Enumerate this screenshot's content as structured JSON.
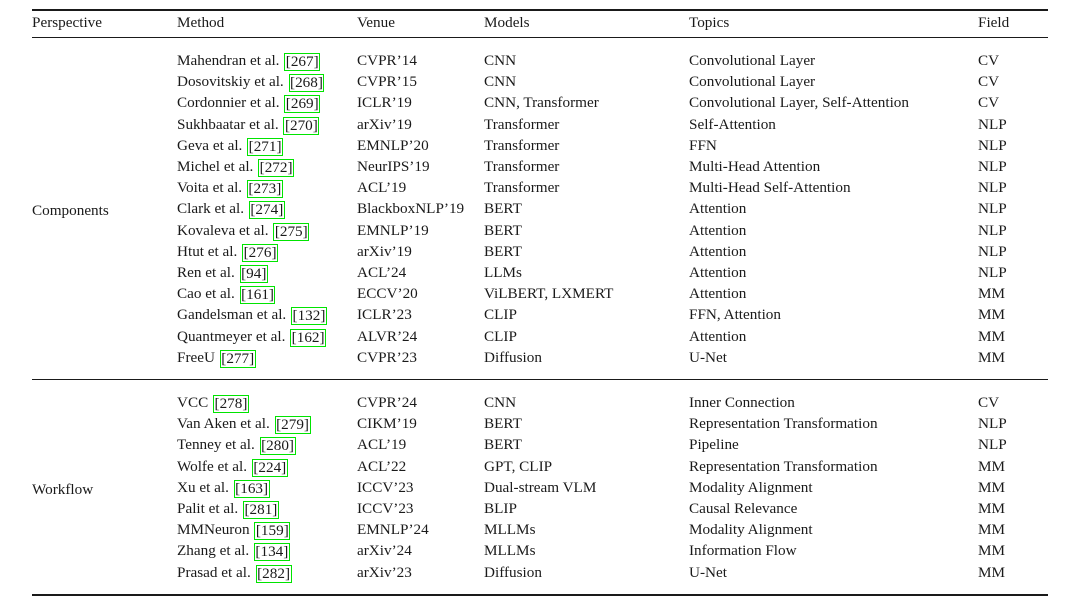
{
  "table": {
    "columns": [
      {
        "key": "perspective",
        "label": "Perspective"
      },
      {
        "key": "method",
        "label": "Method"
      },
      {
        "key": "venue",
        "label": "Venue"
      },
      {
        "key": "models",
        "label": "Models"
      },
      {
        "key": "topics",
        "label": "Topics"
      },
      {
        "key": "field",
        "label": "Field"
      }
    ],
    "citation_box_color": "#00e400",
    "rule_color": "#1a1a1a",
    "groups": [
      {
        "perspective": "Components",
        "rows": [
          {
            "method": "Mahendran et al.",
            "cite": "267",
            "venue": "CVPR’14",
            "models": "CNN",
            "topics": "Convolutional Layer",
            "field": "CV"
          },
          {
            "method": "Dosovitskiy et al.",
            "cite": "268",
            "venue": "CVPR’15",
            "models": "CNN",
            "topics": "Convolutional Layer",
            "field": "CV"
          },
          {
            "method": "Cordonnier et al.",
            "cite": "269",
            "venue": "ICLR’19",
            "models": "CNN, Transformer",
            "topics": "Convolutional Layer, Self-Attention",
            "field": "CV"
          },
          {
            "method": "Sukhbaatar et al.",
            "cite": "270",
            "venue": "arXiv’19",
            "models": "Transformer",
            "topics": "Self-Attention",
            "field": "NLP"
          },
          {
            "method": "Geva et al.",
            "cite": "271",
            "venue": "EMNLP’20",
            "models": "Transformer",
            "topics": "FFN",
            "field": "NLP"
          },
          {
            "method": "Michel et al.",
            "cite": "272",
            "venue": "NeurIPS’19",
            "models": "Transformer",
            "topics": "Multi-Head Attention",
            "field": "NLP"
          },
          {
            "method": "Voita et al.",
            "cite": "273",
            "venue": "ACL’19",
            "models": "Transformer",
            "topics": "Multi-Head Self-Attention",
            "field": "NLP"
          },
          {
            "method": "Clark et al.",
            "cite": "274",
            "venue": "BlackboxNLP’19",
            "models": "BERT",
            "topics": "Attention",
            "field": "NLP"
          },
          {
            "method": "Kovaleva et al.",
            "cite": "275",
            "venue": "EMNLP’19",
            "models": "BERT",
            "topics": "Attention",
            "field": "NLP"
          },
          {
            "method": "Htut et al.",
            "cite": "276",
            "venue": "arXiv’19",
            "models": "BERT",
            "topics": "Attention",
            "field": "NLP"
          },
          {
            "method": "Ren et al.",
            "cite": "94",
            "venue": "ACL’24",
            "models": "LLMs",
            "topics": "Attention",
            "field": "NLP"
          },
          {
            "method": "Cao et al.",
            "cite": "161",
            "venue": "ECCV’20",
            "models": "ViLBERT, LXMERT",
            "topics": "Attention",
            "field": "MM"
          },
          {
            "method": "Gandelsman et al.",
            "cite": "132",
            "venue": "ICLR’23",
            "models": "CLIP",
            "topics": "FFN, Attention",
            "field": "MM"
          },
          {
            "method": "Quantmeyer et al.",
            "cite": "162",
            "venue": "ALVR’24",
            "models": "CLIP",
            "topics": "Attention",
            "field": "MM"
          },
          {
            "method": "FreeU",
            "cite": "277",
            "venue": "CVPR’23",
            "models": "Diffusion",
            "topics": "U-Net",
            "field": "MM"
          }
        ]
      },
      {
        "perspective": "Workflow",
        "rows": [
          {
            "method": "VCC",
            "cite": "278",
            "venue": "CVPR’24",
            "models": "CNN",
            "topics": "Inner Connection",
            "field": "CV"
          },
          {
            "method": "Van Aken et al.",
            "cite": "279",
            "venue": "CIKM’19",
            "models": "BERT",
            "topics": "Representation Transformation",
            "field": "NLP"
          },
          {
            "method": "Tenney et al.",
            "cite": "280",
            "venue": "ACL’19",
            "models": "BERT",
            "topics": "Pipeline",
            "field": "NLP"
          },
          {
            "method": "Wolfe et al.",
            "cite": "224",
            "venue": "ACL’22",
            "models": "GPT, CLIP",
            "topics": "Representation Transformation",
            "field": "MM"
          },
          {
            "method": "Xu et al.",
            "cite": "163",
            "venue": "ICCV’23",
            "models": "Dual-stream VLM",
            "topics": "Modality Alignment",
            "field": "MM"
          },
          {
            "method": "Palit et al.",
            "cite": "281",
            "venue": "ICCV’23",
            "models": "BLIP",
            "topics": "Causal Relevance",
            "field": "MM"
          },
          {
            "method": "MMNeuron",
            "cite": "159",
            "venue": "EMNLP’24",
            "models": "MLLMs",
            "topics": "Modality Alignment",
            "field": "MM"
          },
          {
            "method": "Zhang et al.",
            "cite": "134",
            "venue": "arXiv’24",
            "models": "MLLMs",
            "topics": "Information Flow",
            "field": "MM"
          },
          {
            "method": "Prasad et al.",
            "cite": "282",
            "venue": "arXiv’23",
            "models": "Diffusion",
            "topics": "U-Net",
            "field": "MM"
          }
        ]
      }
    ]
  }
}
